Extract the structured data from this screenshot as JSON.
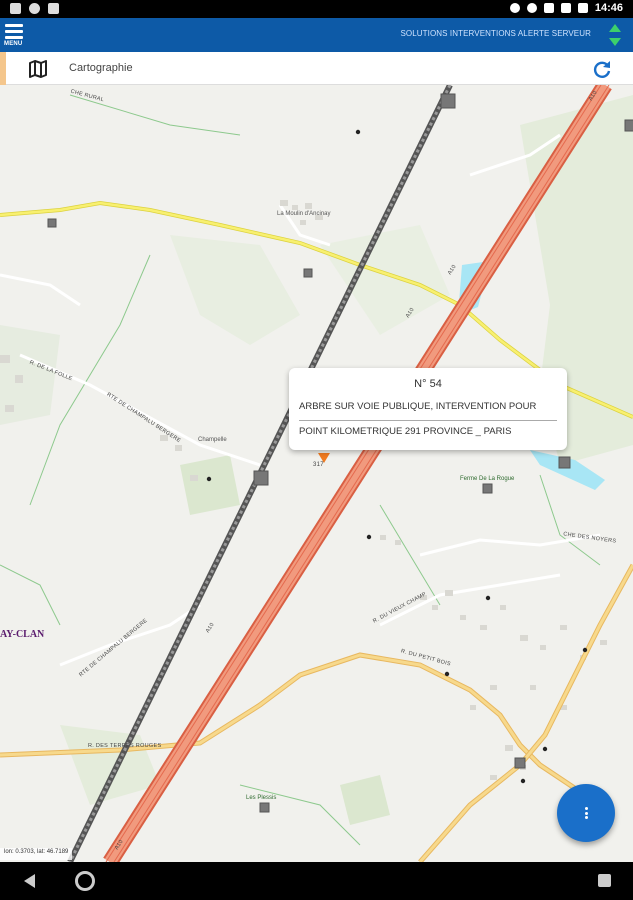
{
  "status_bar": {
    "time": "14:46"
  },
  "app_bar": {
    "menu_label": "MENU",
    "status_text": "SOLUTIONS INTERVENTIONS ALERTE SERVEUR"
  },
  "toolbar": {
    "title": "Cartographie"
  },
  "map": {
    "labels": {
      "le_moulin": "La Moulin d'Ancinay",
      "champelle": "Champelle",
      "ferme": "Ferme De La Rogue",
      "les_plessis": "Les Plessis",
      "place": "AY-CLAN",
      "rue_la_folle": "R. DE LA FOLLE",
      "rte_champalu_1": "RTE DE CHAMPALU BERGERE",
      "rte_champalu_2": "RTE DE CHAMPALU BERGERE",
      "a10_1": "A10",
      "a10_2": "A10",
      "a10_3": "A10",
      "a10_4": "A10",
      "a10_5": "A10",
      "route_top": "CHE RURAL",
      "route_bottom_left": "R. DES TERRES ROUGES",
      "route_bottom_mid": "R. DU PETIT BOIS",
      "rue_noyers": "CHE DES NOYERS",
      "ferme_route": "R. DU VIEUX CHAMP",
      "km_marker": "317"
    },
    "coordinates": "lon: 0.3703, lat: 46.7189",
    "colors": {
      "highway": "#e97c5f",
      "highway_core": "#f6b39c",
      "railway": "#555555",
      "yellow_road": "#f3ea5b",
      "secondary_road": "#f5d27a",
      "water": "#a8e6f5",
      "forest": "#dfe8d3",
      "grass": "#cfe2c2"
    }
  },
  "popup": {
    "number": "N° 54",
    "line1": "ARBRE SUR VOIE PUBLIQUE, INTERVENTION POUR",
    "line2": "POINT KILOMETRIQUE 291 PROVINCE _ PARIS"
  },
  "fab": {
    "icon": "more-vert-icon"
  },
  "nav": {
    "back": "back-icon",
    "home": "home-icon",
    "recents": "recents-icon"
  }
}
